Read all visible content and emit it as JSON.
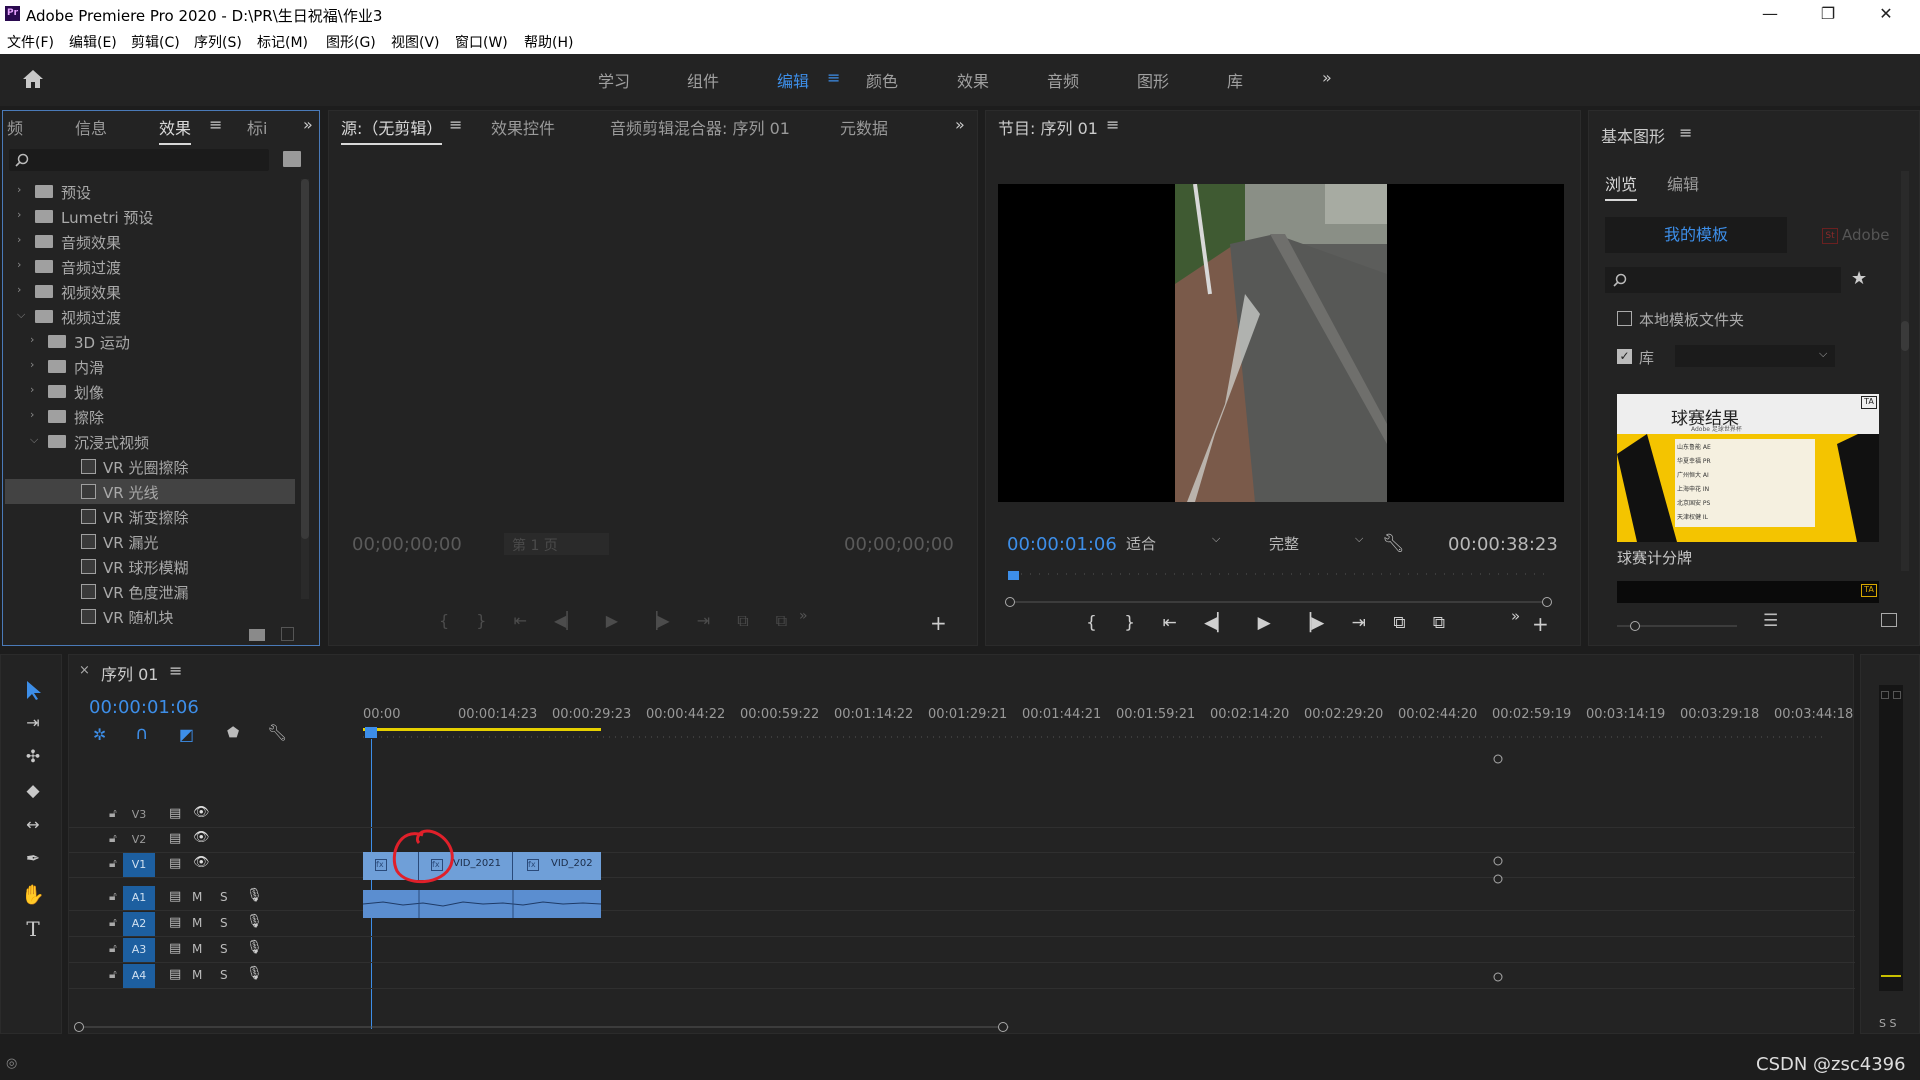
{
  "window": {
    "title": "Adobe Premiere Pro 2020 - D:\\PR\\生日祝福\\作业3",
    "app_icon": "Pr",
    "minimize": "—",
    "restore": "❐",
    "close": "✕"
  },
  "menu": [
    "文件(F)",
    "编辑(E)",
    "剪辑(C)",
    "序列(S)",
    "标记(M)",
    "图形(G)",
    "视图(V)",
    "窗口(W)",
    "帮助(H)"
  ],
  "workspaces": {
    "items": [
      "学习",
      "组件",
      "编辑",
      "颜色",
      "效果",
      "音频",
      "图形",
      "库"
    ],
    "active": "编辑",
    "more": "»"
  },
  "effects_panel": {
    "tabs": [
      "频",
      "信息",
      "效果",
      "标i"
    ],
    "active_tab": "效果",
    "search_placeholder": "",
    "tree": [
      {
        "label": "预设",
        "level": 0,
        "type": "special-folder",
        "expanded": false
      },
      {
        "label": "Lumetri 预设",
        "level": 0,
        "type": "special-folder",
        "expanded": false
      },
      {
        "label": "音频效果",
        "level": 0,
        "type": "folder",
        "expanded": false
      },
      {
        "label": "音频过渡",
        "level": 0,
        "type": "folder",
        "expanded": false
      },
      {
        "label": "视频效果",
        "level": 0,
        "type": "folder",
        "expanded": false
      },
      {
        "label": "视频过渡",
        "level": 0,
        "type": "folder",
        "expanded": true
      },
      {
        "label": "3D 运动",
        "level": 1,
        "type": "folder",
        "expanded": false
      },
      {
        "label": "内滑",
        "level": 1,
        "type": "folder",
        "expanded": false
      },
      {
        "label": "划像",
        "level": 1,
        "type": "folder",
        "expanded": false
      },
      {
        "label": "擦除",
        "level": 1,
        "type": "folder",
        "expanded": false
      },
      {
        "label": "沉浸式视频",
        "level": 1,
        "type": "folder",
        "expanded": true
      },
      {
        "label": "VR 光圈擦除",
        "level": 2,
        "type": "effect"
      },
      {
        "label": "VR 光线",
        "level": 2,
        "type": "effect",
        "selected": true
      },
      {
        "label": "VR 渐变擦除",
        "level": 2,
        "type": "effect"
      },
      {
        "label": "VR 漏光",
        "level": 2,
        "type": "effect"
      },
      {
        "label": "VR 球形模糊",
        "level": 2,
        "type": "effect"
      },
      {
        "label": "VR 色度泄漏",
        "level": 2,
        "type": "effect"
      },
      {
        "label": "VR 随机块",
        "level": 2,
        "type": "effect"
      }
    ]
  },
  "source_panel": {
    "tabs": [
      "源:（无剪辑）",
      "效果控件",
      "音频剪辑混合器: 序列 01",
      "元数据"
    ],
    "tc_left": "00;00;00;00",
    "tc_right": "00;00;00;00",
    "page": "第 1 页"
  },
  "program_panel": {
    "title": "节目: 序列 01",
    "tc_current": "00:00:01:06",
    "fit": "适合",
    "quality": "完整",
    "tc_duration": "00:00:38:23"
  },
  "essential_graphics": {
    "title": "基本图形",
    "tabs": [
      "浏览",
      "编辑"
    ],
    "subtabs": [
      "我的模板",
      "Adobe"
    ],
    "checkbox_local": "本地模板文件夹",
    "checkbox_lib": "库",
    "template_name": "球赛计分牌",
    "thumb_title": "球赛结果",
    "thumb_sub": "Adobe 足球世界杯",
    "thumb_rows": [
      "山东鲁能 AE",
      "华夏幸福 PR",
      "广州恒大 AI",
      "上海申花 IN",
      "北京国安 PS",
      "天津权健 IL"
    ]
  },
  "timeline": {
    "sequence": "序列 01",
    "tc": "00:00:01:06",
    "ruler": [
      "00:00",
      "00:00:14:23",
      "00:00:29:23",
      "00:00:44:22",
      "00:00:59:22",
      "00:01:14:22",
      "00:01:29:21",
      "00:01:44:21",
      "00:01:59:21",
      "00:02:14:20",
      "00:02:29:20",
      "00:02:44:20",
      "00:02:59:19",
      "00:03:14:19",
      "00:03:29:18",
      "00:03:44:18"
    ],
    "video_tracks": [
      "V3",
      "V2",
      "V1"
    ],
    "audio_tracks": [
      "A1",
      "A2",
      "A3",
      "A4"
    ],
    "clip_labels": [
      "VID_2021",
      "VID_202"
    ],
    "mute": "M",
    "solo": "S"
  },
  "meters": {
    "label": "S S"
  },
  "watermark": "CSDN @zsc4396",
  "colors": {
    "accent": "#3d8ee8",
    "timecode": "#3d8ee8",
    "clip_video": "#6f9fd8",
    "clip_audio": "#5b8ed0",
    "track_target": "#1d5fa0",
    "work_area": "#e6d000",
    "annotation": "#e0202a"
  }
}
